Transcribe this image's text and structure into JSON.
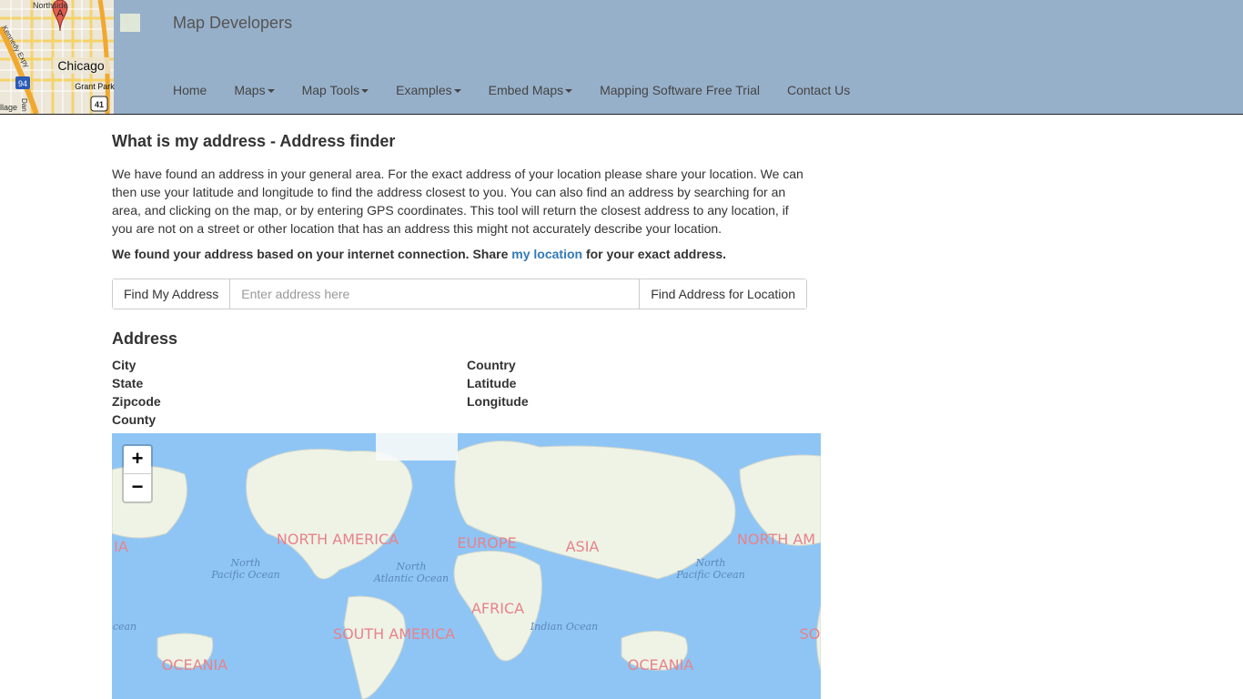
{
  "header": {
    "brand": "Map Developers",
    "logo_labels": {
      "place": "Chicago",
      "park": "Grant Park",
      "north": "Northside",
      "road": "Kennedy Expy",
      "interstate": "94",
      "highway": "41",
      "village": "llage",
      "dan": "Dan R",
      "marker": "A"
    },
    "nav": [
      {
        "label": "Home",
        "dropdown": false
      },
      {
        "label": "Maps",
        "dropdown": true
      },
      {
        "label": "Map Tools",
        "dropdown": true
      },
      {
        "label": "Examples",
        "dropdown": true
      },
      {
        "label": "Embed Maps",
        "dropdown": true
      },
      {
        "label": "Mapping Software Free Trial",
        "dropdown": false
      },
      {
        "label": "Contact Us",
        "dropdown": false
      }
    ]
  },
  "page": {
    "title": "What is my address - Address finder",
    "intro": "We have found an address in your general area. For the exact address of your location please share your location. We can then use your latitude and longitude to find the address closest to you. You can also find an address by searching for an area, and clicking on the map, or by entering GPS coordinates. This tool will return the closest address to any location, if you are not on a street or other location that has an address this might not accurately describe your location.",
    "notice_before": "We found your address based on your internet connection. Share ",
    "notice_link": "my location",
    "notice_after": " for your exact address."
  },
  "search": {
    "find_my_address": "Find My Address",
    "placeholder": "Enter address here",
    "find_address_button": "Find Address for Location"
  },
  "address": {
    "heading": "Address",
    "left_fields": [
      "City",
      "State",
      "Zipcode",
      "County"
    ],
    "right_fields": [
      "Country",
      "Latitude",
      "Longitude"
    ]
  },
  "map": {
    "zoom_in": "+",
    "zoom_out": "−",
    "continents": {
      "asia_left": "IA",
      "north_america": "NORTH AMERICA",
      "europe": "EUROPE",
      "asia": "ASIA",
      "north_america_right": "NORTH AM",
      "africa": "AFRICA",
      "south_america": "SOUTH AMERICA",
      "south_right": "SO",
      "oceania_left": "OCEANIA",
      "oceania_right": "OCEANIA"
    },
    "oceans": {
      "north_pacific_1": "North",
      "north_pacific_2": "Pacific Ocean",
      "north_atlantic_1": "North",
      "north_atlantic_2": "Atlantic Ocean",
      "indian": "Indian Ocean",
      "ocean_left": "cean",
      "north_pacific_right_1": "North",
      "north_pacific_right_2": "Pacific Ocean"
    },
    "colors": {
      "water": "#8ec5f5",
      "land": "#eef3e6",
      "label": "#e8828a"
    }
  }
}
